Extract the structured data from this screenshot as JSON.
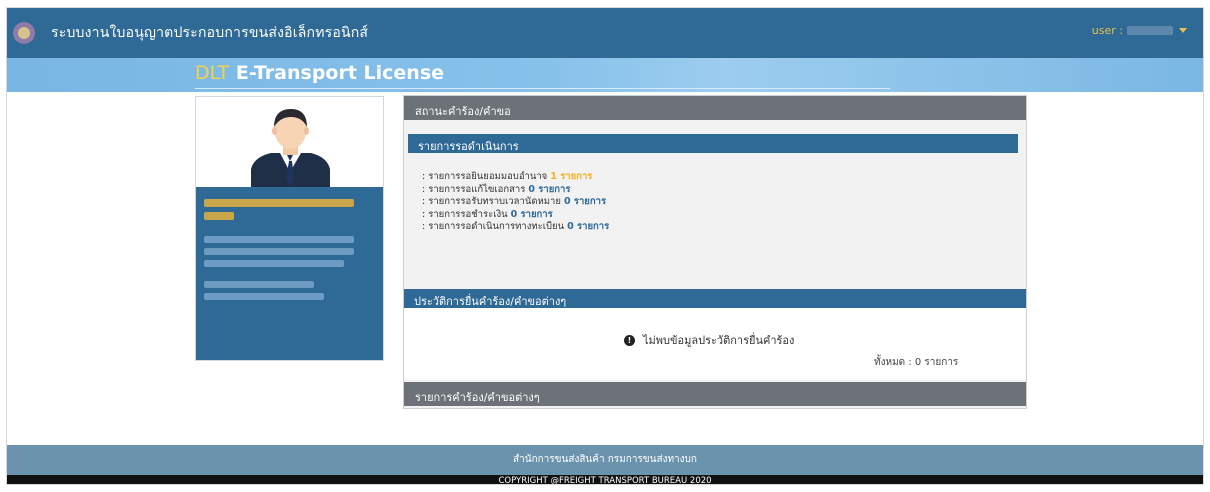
{
  "header": {
    "system_title": "ระบบงานใบอนุญาตประกอบการขนส่งอิเล็กทรอนิกส์",
    "user_label": "user :"
  },
  "banner": {
    "dlt": "DLT",
    "title": "E-Transport License"
  },
  "status_panel": {
    "title": "สถานะคำร้อง/คำขอ",
    "pending_title": "รายการรอดำเนินการ",
    "items": [
      {
        "label": ": รายการรอยินยอมมอบอำนาจ",
        "count": "1 รายการ"
      },
      {
        "label": ": รายการรอแก้ไขเอกสาร",
        "count": "0 รายการ"
      },
      {
        "label": ": รายการรอรับทราบเวลานัดหมาย",
        "count": "0 รายการ"
      },
      {
        "label": ": รายการรอชำระเงิน",
        "count": "0 รายการ"
      },
      {
        "label": ": รายการรอดำเนินการทางทะเบียน",
        "count": "0 รายการ"
      }
    ]
  },
  "history": {
    "title": "ประวัติการยื่นคำร้อง/คำขอต่างๆ",
    "empty_message": "ไม่พบข้อมูลประวัติการยื่นคำร้อง",
    "total": "ทั้งหมด : 0 รายการ"
  },
  "requests": {
    "title": "รายการคำร้อง/คำขอต่างๆ"
  },
  "footer": {
    "org": "สำนักการขนส่งสินค้า กรมการขนส่งทางบก",
    "copyright": "COPYRIGHT @FREIGHT TRANSPORT BUREAU 2020"
  },
  "colors": {
    "primary": "#2f6996",
    "accent": "#f4d34a",
    "panel_header": "#6c7278"
  },
  "icons": {
    "logo": "emblem-icon",
    "user_caret": "caret-down-icon",
    "info": "info-circle-icon",
    "avatar": "businessman-avatar-icon"
  }
}
